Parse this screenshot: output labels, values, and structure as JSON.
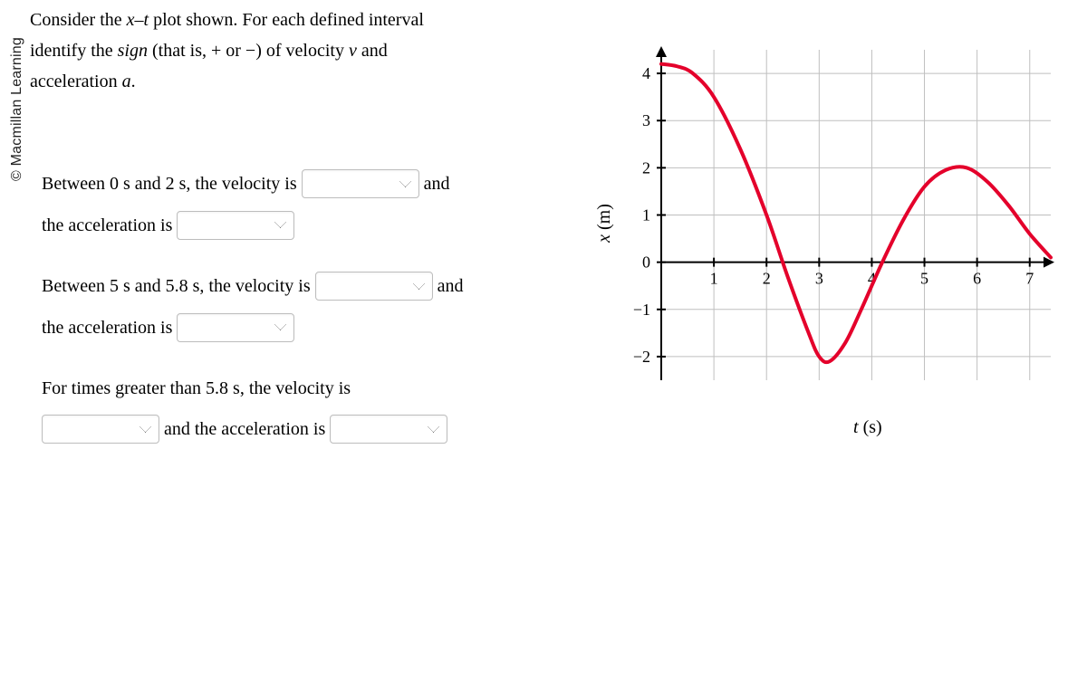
{
  "copyright": "© Macmillan Learning",
  "intro": {
    "line1_a": "Consider the ",
    "line1_b": "x–t",
    "line1_c": " plot shown. For each defined interval",
    "line2_a": "identify the ",
    "line2_b": "sign",
    "line2_c": " (that is, + or −) of velocity ",
    "line2_d": "v",
    "line2_e": " and",
    "line3_a": "acceleration ",
    "line3_b": "a",
    "line3_c": "."
  },
  "q1": {
    "part1": "Between 0 s and 2 s, the velocity is ",
    "and": " and",
    "part2": "the acceleration is "
  },
  "q2": {
    "part1": "Between 5 s and 5.8 s, the velocity is ",
    "and": " and",
    "part2": "the acceleration is "
  },
  "q3": {
    "part1": "For times greater than 5.8 s, the velocity is",
    "mid": " and the acceleration is "
  },
  "axes": {
    "ylabel_var": "x",
    "ylabel_unit": " (m)",
    "xlabel_var": "t",
    "xlabel_unit": " (s)",
    "xticks": [
      "1",
      "2",
      "3",
      "4",
      "5",
      "6",
      "7"
    ],
    "yticks": [
      "-2",
      "-1",
      "0",
      "1",
      "2",
      "3",
      "4"
    ]
  },
  "chart_data": {
    "type": "line",
    "title": "",
    "xlabel": "t (s)",
    "ylabel": "x (m)",
    "xlim": [
      0,
      7.4
    ],
    "ylim": [
      -2.5,
      4.5
    ],
    "grid": true,
    "series": [
      {
        "name": "x(t)",
        "color": "#e4002b",
        "x": [
          0.0,
          0.3,
          0.6,
          1.0,
          1.5,
          2.0,
          2.4,
          2.8,
          3.0,
          3.2,
          3.5,
          3.8,
          4.2,
          4.6,
          5.0,
          5.4,
          5.8,
          6.2,
          6.6,
          7.0,
          7.4
        ],
        "values": [
          4.2,
          4.15,
          4.0,
          3.5,
          2.4,
          1.0,
          -0.3,
          -1.5,
          -2.0,
          -2.1,
          -1.7,
          -1.0,
          0.0,
          0.9,
          1.6,
          1.95,
          2.0,
          1.7,
          1.2,
          0.6,
          0.1
        ]
      }
    ]
  }
}
